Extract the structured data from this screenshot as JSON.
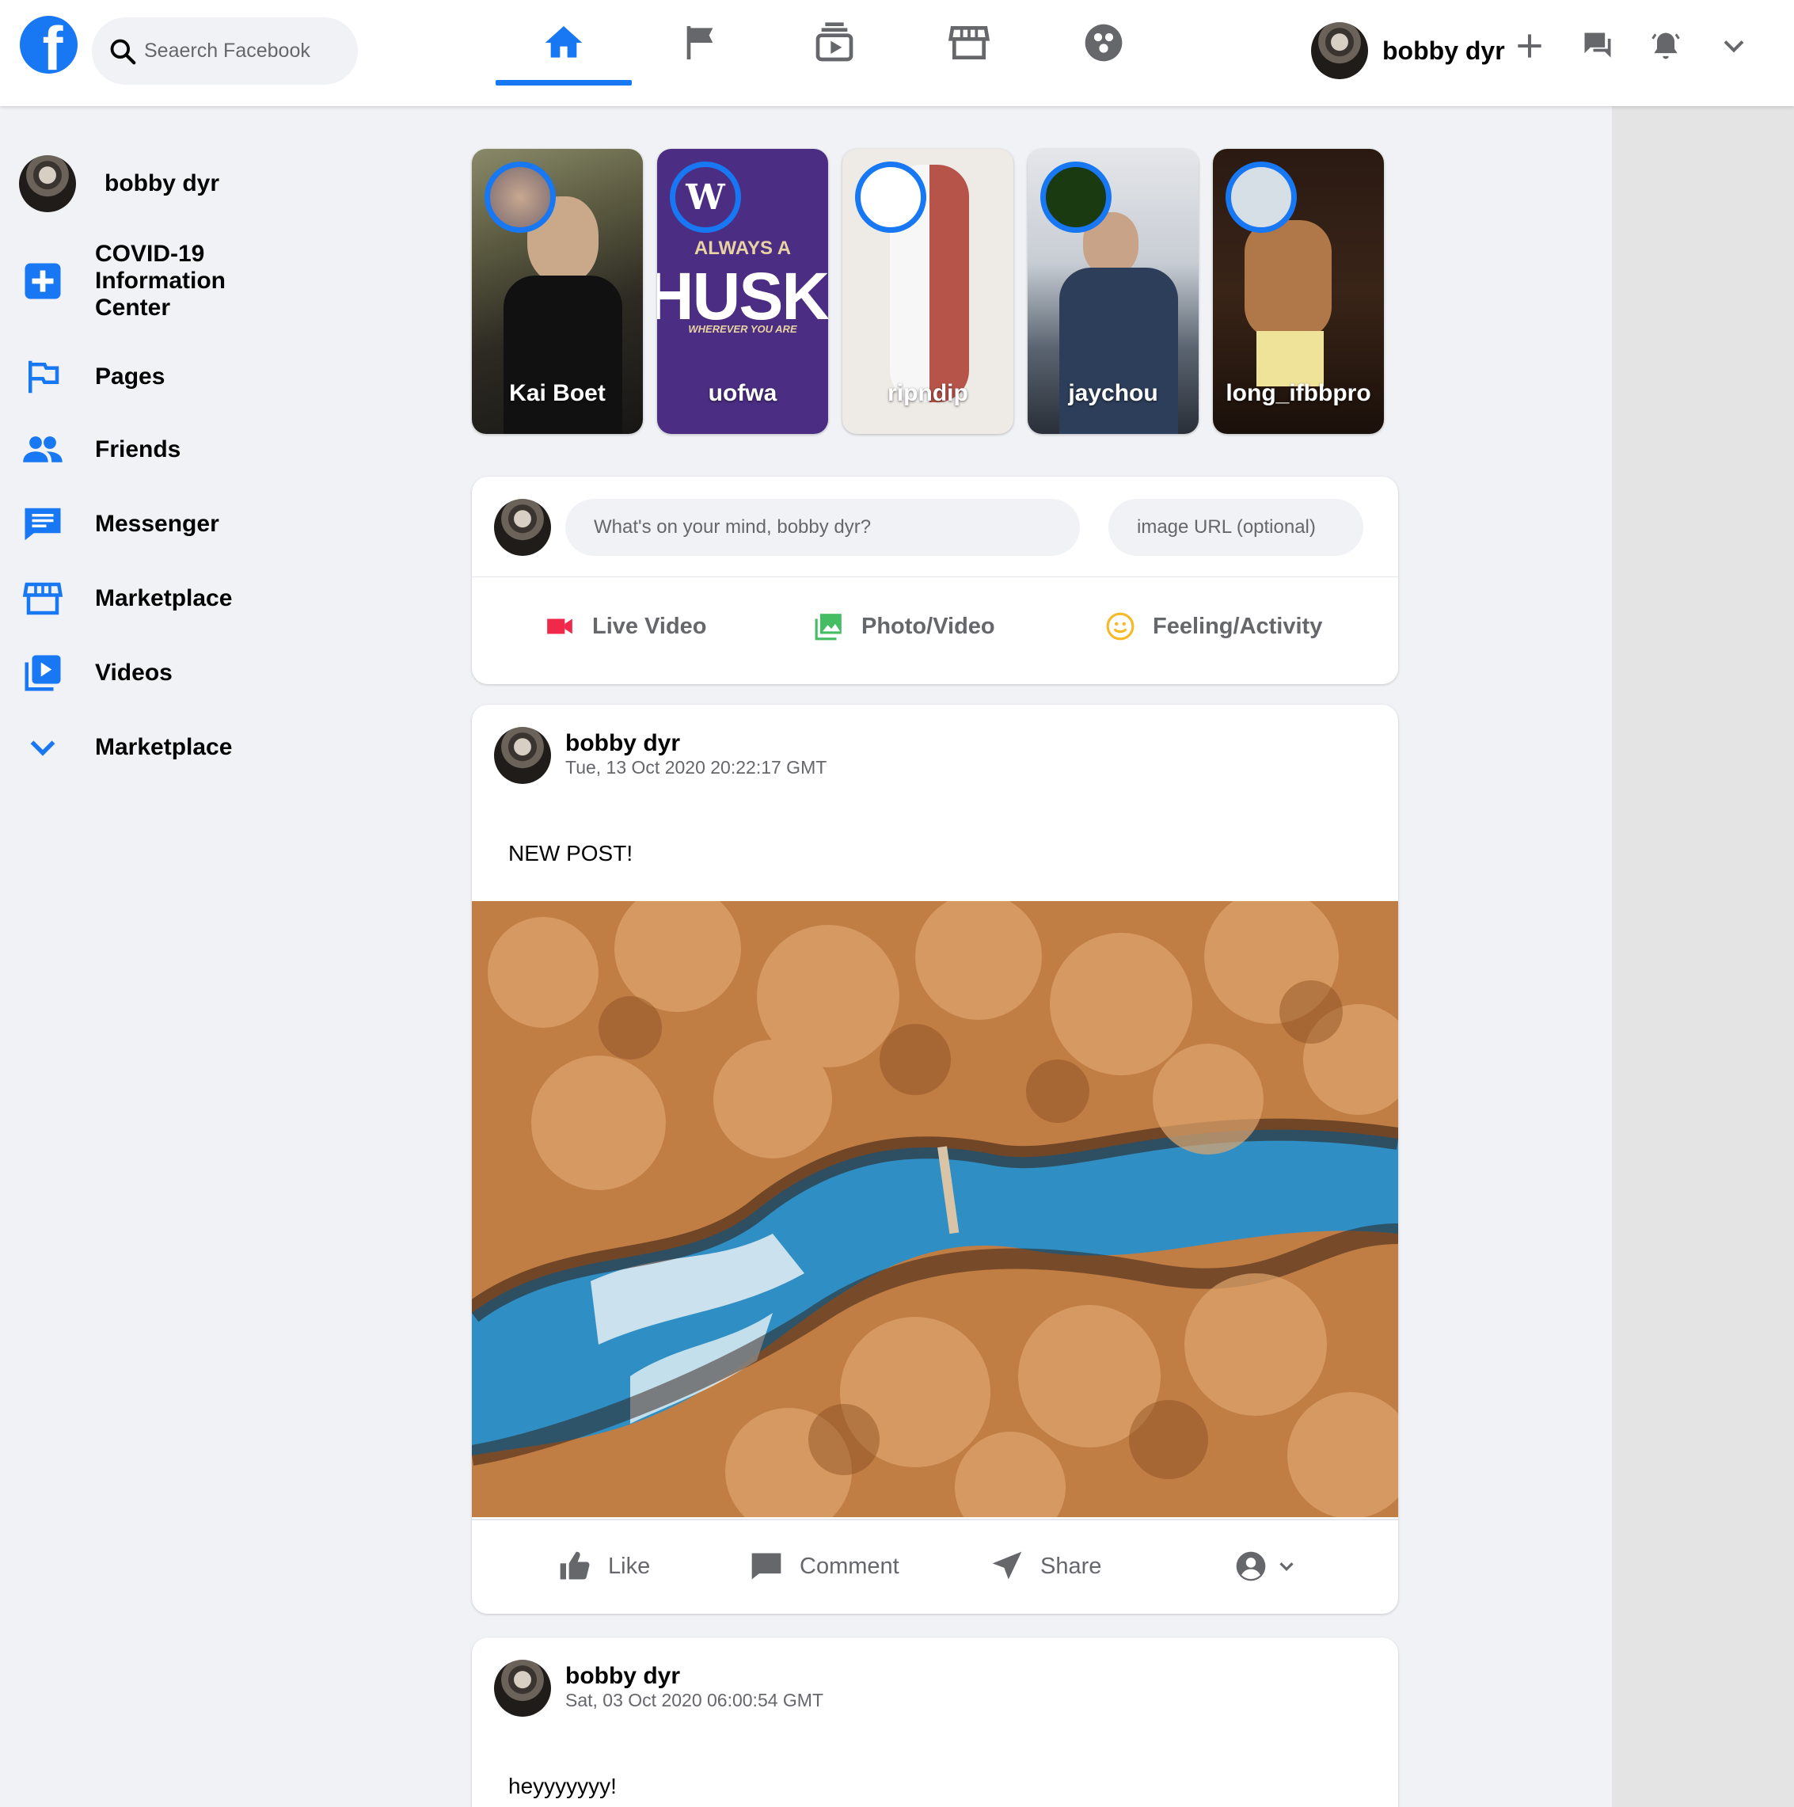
{
  "search": {
    "placeholder": "Seaerch Facebook"
  },
  "nav": {
    "tabs": [
      {
        "name": "home",
        "icon": "home-icon",
        "active": true
      },
      {
        "name": "pages",
        "icon": "flag-icon",
        "active": false
      },
      {
        "name": "watch",
        "icon": "video-icon",
        "active": false
      },
      {
        "name": "marketplace",
        "icon": "store-icon",
        "active": false
      },
      {
        "name": "groups",
        "icon": "groups-icon",
        "active": false
      }
    ]
  },
  "profile": {
    "name": "bobby dyr"
  },
  "sidebar": {
    "items": [
      {
        "label": "bobby dyr",
        "icon": "avatar"
      },
      {
        "label": "COVID-19 Information Center",
        "icon": "plus-square-icon"
      },
      {
        "label": "Pages",
        "icon": "flag-icon"
      },
      {
        "label": "Friends",
        "icon": "friends-icon"
      },
      {
        "label": "Messenger",
        "icon": "message-icon"
      },
      {
        "label": "Marketplace",
        "icon": "store-icon"
      },
      {
        "label": "Videos",
        "icon": "video-icon"
      },
      {
        "label": "Marketplace",
        "icon": "chevron-down-icon"
      }
    ]
  },
  "stories": [
    {
      "name": "Kai Boet"
    },
    {
      "name": "uofwa"
    },
    {
      "name": "ripndip"
    },
    {
      "name": "jaychou"
    },
    {
      "name": "long_ifbbpro"
    }
  ],
  "story_art": {
    "uofwa_letter": "W",
    "uofwa_line1": "ALWAYS A",
    "uofwa_line2": "HUSKY",
    "uofwa_line3": "WHEREVER YOU ARE"
  },
  "composer": {
    "status_placeholder": "What's on your mind, bobby dyr?",
    "image_placeholder": "image URL (optional)",
    "actions": [
      "Live Video",
      "Photo/Video",
      "Feeling/Activity"
    ]
  },
  "posts": [
    {
      "author": "bobby dyr",
      "date": "Tue, 13 Oct 2020 20:22:17 GMT",
      "text": "NEW POST!"
    },
    {
      "author": "bobby dyr",
      "date": "Sat, 03 Oct 2020 06:00:54 GMT",
      "text": "heyyyyyyy!"
    }
  ],
  "post_actions": {
    "like": "Like",
    "comment": "Comment",
    "share": "Share"
  },
  "colors": {
    "brand": "#1877f2",
    "live": "#f02849",
    "photo": "#45bd62",
    "feeling": "#f7b928"
  }
}
